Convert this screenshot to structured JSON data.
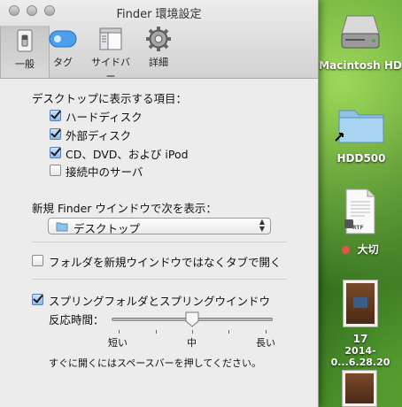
{
  "window": {
    "title": "Finder 環境設定",
    "toolbar": [
      {
        "label": "一般",
        "icon": "switch-icon"
      },
      {
        "label": "タグ",
        "icon": "tag-icon"
      },
      {
        "label": "サイドバー",
        "icon": "sidebar-icon"
      },
      {
        "label": "詳細",
        "icon": "gear-icon"
      }
    ],
    "selected_tab": "一般"
  },
  "general": {
    "desktop_heading": "デスクトップに表示する項目：",
    "desktop_items": [
      {
        "label": "ハードディスク",
        "checked": true
      },
      {
        "label": "外部ディスク",
        "checked": true
      },
      {
        "label": "CD、DVD、および iPod",
        "checked": true
      },
      {
        "label": "接続中のサーバ",
        "checked": false
      }
    ],
    "new_window_label": "新規 Finder ウインドウで次を表示：",
    "new_window_value": "デスクトップ",
    "open_folders_in_tabs": {
      "label": "フォルダを新規ウインドウではなくタブで開く",
      "checked": false
    },
    "spring_loading": {
      "label": "スプリングフォルダとスプリングウインドウ",
      "checked": true
    },
    "delay_label": "反応時間：",
    "delay_ticks": [
      "短い",
      "中",
      "長い"
    ],
    "delay_value": 0.5,
    "hint": "すぐに開くにはスペースバーを押してください。"
  },
  "desktop": {
    "icons": [
      {
        "label": "Macintosh HD",
        "icon": "hard-drive-icon"
      },
      {
        "label": "HDD500",
        "icon": "folder-alias-icon"
      },
      {
        "label": "大切",
        "icon": "rtf-document-icon",
        "tag_color": "#e5534b",
        "badge": "RTF"
      },
      {
        "label": "17",
        "label2": "2014-0...6.28.20",
        "icon": "photo-icon"
      }
    ]
  }
}
